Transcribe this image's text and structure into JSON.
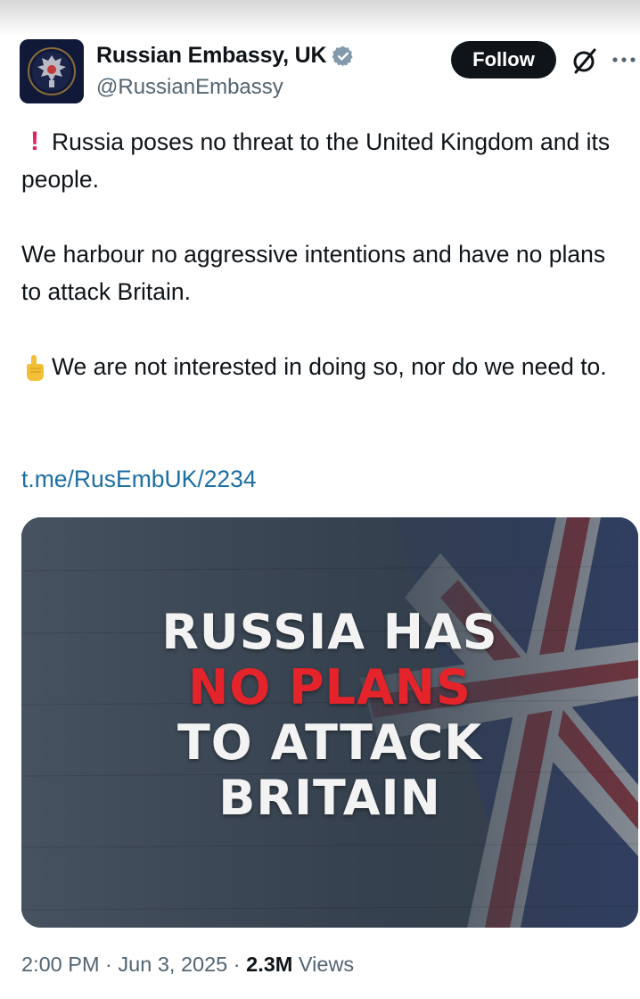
{
  "post": {
    "author_name": "Russian Embassy, UK",
    "author_handle": "@RussianEmbassy",
    "follow_label": "Follow",
    "paragraph1": "Russia poses no threat to the United Kingdom and its people.",
    "paragraph2": "We harbour no aggressive intentions and have no plans to attack Britain.",
    "paragraph3": "We are not interested in doing so, nor do we need to.",
    "link": "t.me/RusEmbUK/2234",
    "image": {
      "line1": "RUSSIA HAS",
      "line2": "NO PLANS",
      "line3": "TO ATTACK",
      "line4": "BRITAIN"
    },
    "time": "2:00 PM",
    "date": "Jun 3, 2025",
    "views_count": "2.3M",
    "views_label": "Views"
  },
  "icons": {
    "avatar": "embassy-emblem",
    "verified": "verified-badge-icon",
    "grok": "grok-icon",
    "more": "more-icon",
    "exclamation": "red-exclamation-emoji",
    "finger": "index-pointing-up-emoji"
  },
  "colors": {
    "link": "#1d6fa5",
    "follow_bg": "#0f1419",
    "verified": "#829aab",
    "headline_red": "#e5232b"
  }
}
